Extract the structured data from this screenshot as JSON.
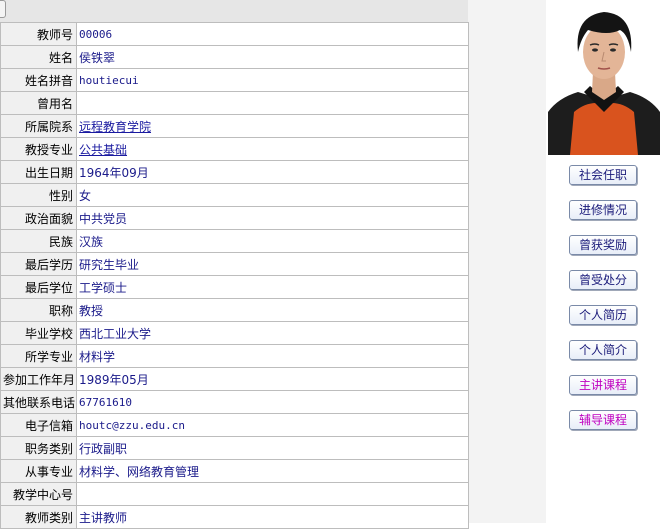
{
  "profile": {
    "rows": [
      {
        "label": "教师号",
        "value": "00006",
        "mono": true
      },
      {
        "label": "姓名",
        "value": "侯铁翠"
      },
      {
        "label": "姓名拼音",
        "value": "houtiecui",
        "mono": true
      },
      {
        "label": "曾用名",
        "value": ""
      },
      {
        "label": "所属院系",
        "value": "远程教育学院",
        "link": true
      },
      {
        "label": "教授专业",
        "value": "公共基础",
        "link": true
      },
      {
        "label": "出生日期",
        "value": "1964年09月"
      },
      {
        "label": "性别",
        "value": "女"
      },
      {
        "label": "政治面貌",
        "value": "中共党员"
      },
      {
        "label": "民族",
        "value": "汉族"
      },
      {
        "label": "最后学历",
        "value": "研究生毕业"
      },
      {
        "label": "最后学位",
        "value": "工学硕士"
      },
      {
        "label": "职称",
        "value": "教授"
      },
      {
        "label": "毕业学校",
        "value": "西北工业大学"
      },
      {
        "label": "所学专业",
        "value": "材料学"
      },
      {
        "label": "参加工作年月",
        "value": "1989年05月"
      },
      {
        "label": "其他联系电话",
        "value": "67761610",
        "mono": true
      },
      {
        "label": "电子信箱",
        "value": "houtc@zzu.edu.cn",
        "mono": true
      },
      {
        "label": "职务类别",
        "value": "行政副职"
      },
      {
        "label": "从事专业",
        "value": "材料学、网络教育管理"
      },
      {
        "label": "教学中心号",
        "value": ""
      },
      {
        "label": "教师类别",
        "value": "主讲教师"
      }
    ]
  },
  "sidebar": {
    "buttons": [
      {
        "name": "social-positions-button",
        "label": "社会任职",
        "color": "#1a1a7a"
      },
      {
        "name": "training-button",
        "label": "进修情况",
        "color": "#1a1a7a"
      },
      {
        "name": "awards-button",
        "label": "曾获奖励",
        "color": "#1a1a7a"
      },
      {
        "name": "sanctions-button",
        "label": "曾受处分",
        "color": "#1a1a7a"
      },
      {
        "name": "resume-button",
        "label": "个人简历",
        "color": "#1a1a7a"
      },
      {
        "name": "bio-button",
        "label": "个人简介",
        "color": "#1a1a7a"
      },
      {
        "name": "main-courses-button",
        "label": "主讲课程",
        "color": "#c000c0"
      },
      {
        "name": "tutoring-courses-button",
        "label": "辅导课程",
        "color": "#c000c0"
      }
    ]
  },
  "colors": {
    "label_bg": "#f0f0f0",
    "value_text": "#1a1a8a",
    "border": "#bdbdbd"
  }
}
